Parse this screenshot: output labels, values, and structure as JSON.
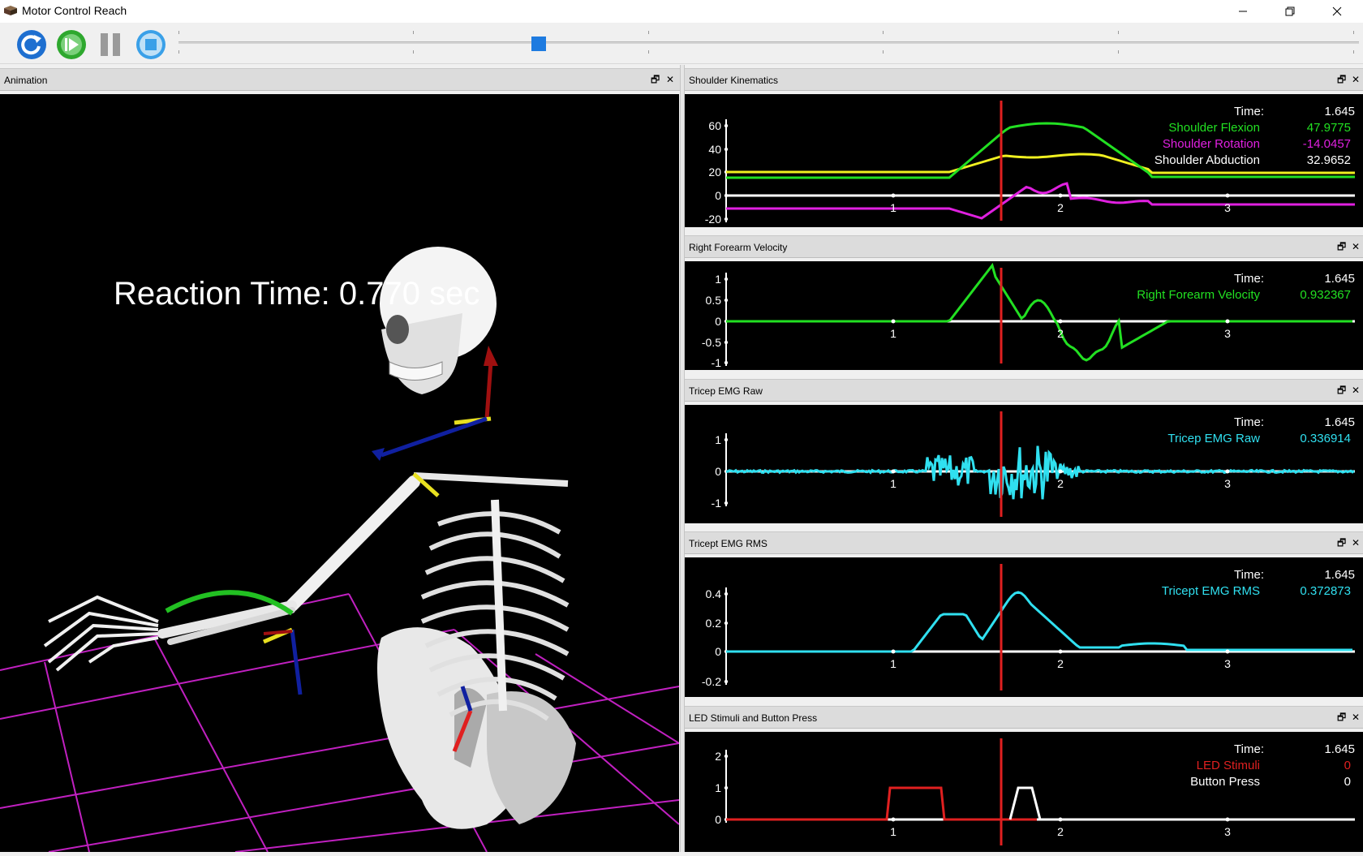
{
  "window": {
    "title": "Motor Control Reach"
  },
  "toolbar": {
    "slider_position": 0.305
  },
  "animation": {
    "title": "Animation",
    "reaction_text": "Reaction Time: 0.770 sec"
  },
  "time_value": "1.645",
  "time_label": "Time:",
  "colors": {
    "green": "#22e022",
    "magenta": "#e020e0",
    "yellow": "#f0f020",
    "white": "#ffffff",
    "cyan": "#30e0f0",
    "red": "#e02020",
    "cursor": "#e02020"
  },
  "panels": [
    {
      "title": "Shoulder Kinematics",
      "yticks": [
        "60",
        "40",
        "20",
        "0",
        "-20"
      ],
      "xticks": [
        "1",
        "2",
        "3"
      ],
      "legend": [
        {
          "label": "Shoulder Flexion",
          "value": "47.9775",
          "color": "#22e022"
        },
        {
          "label": "Shoulder Rotation",
          "value": "-14.0457",
          "color": "#e020e0"
        },
        {
          "label": "Shoulder Abduction",
          "value": "32.9652",
          "color": "#ffffff"
        }
      ]
    },
    {
      "title": "Right Forearm Velocity",
      "yticks": [
        "1",
        "0.5",
        "0",
        "-0.5",
        "-1"
      ],
      "xticks": [
        "1",
        "2",
        "3"
      ],
      "legend": [
        {
          "label": "Right Forearm Velocity",
          "value": "0.932367",
          "color": "#22e022"
        }
      ]
    },
    {
      "title": "Tricep EMG Raw",
      "yticks": [
        "1",
        "0",
        "-1"
      ],
      "xticks": [
        "1",
        "2",
        "3"
      ],
      "legend": [
        {
          "label": "Tricep EMG Raw",
          "value": "0.336914",
          "color": "#30e0f0"
        }
      ]
    },
    {
      "title": "Tricept EMG RMS",
      "yticks": [
        "0.4",
        "0.2",
        "0",
        "-0.2"
      ],
      "xticks": [
        "1",
        "2",
        "3"
      ],
      "legend": [
        {
          "label": "Tricept EMG RMS",
          "value": "0.372873",
          "color": "#30e0f0"
        }
      ]
    },
    {
      "title": "LED Stimuli and Button Press",
      "yticks": [
        "2",
        "1",
        "0"
      ],
      "xticks": [
        "1",
        "2",
        "3"
      ],
      "legend": [
        {
          "label": "LED Stimuli",
          "value": "0",
          "color": "#e02020"
        },
        {
          "label": "Button Press",
          "value": "0",
          "color": "#ffffff"
        }
      ]
    }
  ]
}
